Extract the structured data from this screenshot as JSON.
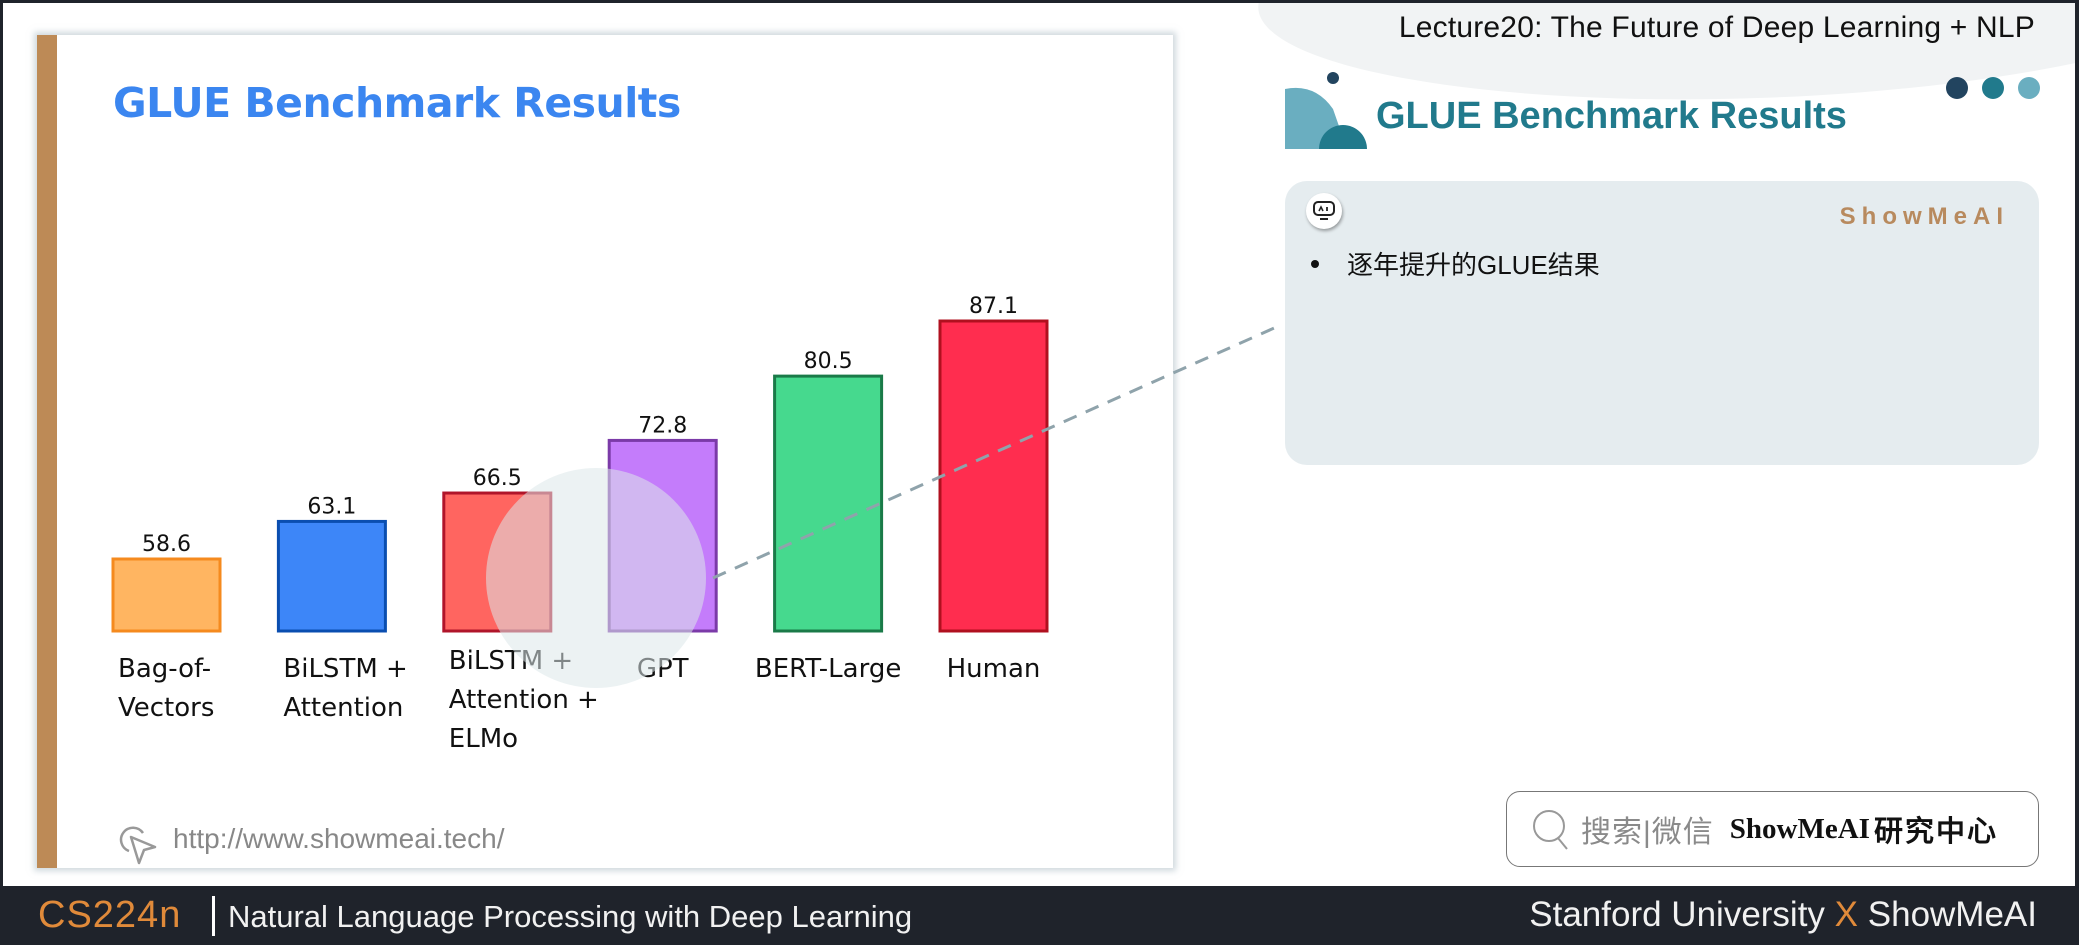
{
  "header": {
    "lecture_title": "Lecture20:  The Future of Deep Learning + NLP",
    "section_title": "GLUE Benchmark Results",
    "dot_colors": [
      "#22445f",
      "#217a8c",
      "#6aaec0"
    ]
  },
  "slide": {
    "title": "GLUE Benchmark Results",
    "url": "http://www.showmeai.tech/",
    "accent_color": "#bd8a56",
    "title_color": "#3b86f0"
  },
  "chart_data": {
    "type": "bar",
    "title": "GLUE Benchmark Results",
    "xlabel": "",
    "ylabel": "",
    "categories": [
      [
        "Bag-of-",
        "Vectors"
      ],
      [
        "BiLSTM +",
        "Attention"
      ],
      [
        "BiLSTM +",
        "Attention +",
        "ELMo"
      ],
      [
        "GPT"
      ],
      [
        "BERT-Large"
      ],
      [
        "Human"
      ]
    ],
    "category_names": [
      "Bag-of-Vectors",
      "BiLSTM + Attention",
      "BiLSTM + Attention + ELMo",
      "GPT",
      "BERT-Large",
      "Human"
    ],
    "values": [
      58.6,
      63.1,
      66.5,
      72.8,
      80.5,
      87.1
    ],
    "value_labels": [
      "58.6",
      "63.1",
      "66.5",
      "72.8",
      "80.5",
      "87.1"
    ],
    "fill_colors": [
      "#ffb561",
      "#3d86f8",
      "#ff6560",
      "#c47cfb",
      "#46d98e",
      "#ff2d4f"
    ],
    "stroke_colors": [
      "#f58a1e",
      "#0a4eb0",
      "#b0152a",
      "#7b3aa8",
      "#1a7a48",
      "#b0101f"
    ],
    "ylim": [
      50,
      92
    ],
    "grid": false,
    "legend": "none"
  },
  "note": {
    "brand": "ShowMeAI",
    "badge_text": "AI",
    "bullets": [
      "逐年提升的GLUE结果"
    ]
  },
  "search": {
    "placeholder": "搜索|微信",
    "brand": "ShowMeAI",
    "brand_suffix": "研究中心"
  },
  "footer": {
    "course_code": "CS224n",
    "course_name": "Natural Language Processing with Deep Learning",
    "right_prefix": "Stanford University ",
    "right_x": "X",
    "right_suffix": " ShowMeAI"
  }
}
